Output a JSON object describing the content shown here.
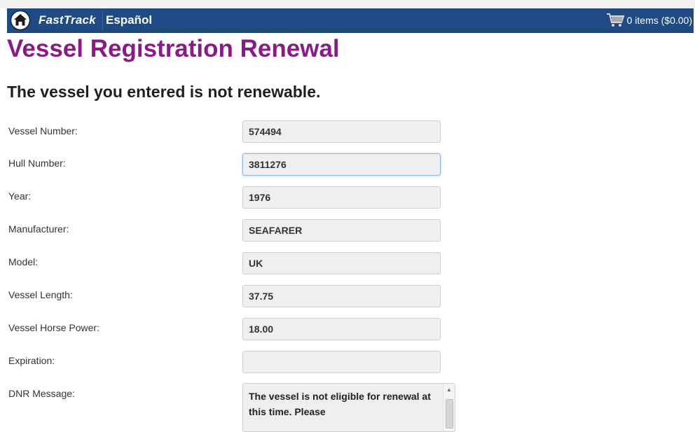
{
  "header": {
    "brand": "FastTrack",
    "language_link": "Español",
    "cart_text": "0 items ($0.00)",
    "home_icon": "home-icon",
    "cart_icon": "shopping-cart-icon"
  },
  "page": {
    "title": "Vessel Registration Renewal",
    "status_message": "The vessel you entered is not renewable."
  },
  "fields": [
    {
      "label": "Vessel Number:",
      "value": "574494"
    },
    {
      "label": "Hull Number:",
      "value": "3811276"
    },
    {
      "label": "Year:",
      "value": "1976"
    },
    {
      "label": "Manufacturer:",
      "value": "SEAFARER"
    },
    {
      "label": "Model:",
      "value": "UK"
    },
    {
      "label": "Vessel Length:",
      "value": "37.75"
    },
    {
      "label": "Vessel Horse Power:",
      "value": "18.00"
    },
    {
      "label": "Expiration:",
      "value": ""
    }
  ],
  "dnr": {
    "label": "DNR Message:",
    "text": "The vessel is not eligible for renewal at this time.  Please"
  },
  "colors": {
    "navbar": "#1f4a84",
    "title": "#8b1a89"
  }
}
